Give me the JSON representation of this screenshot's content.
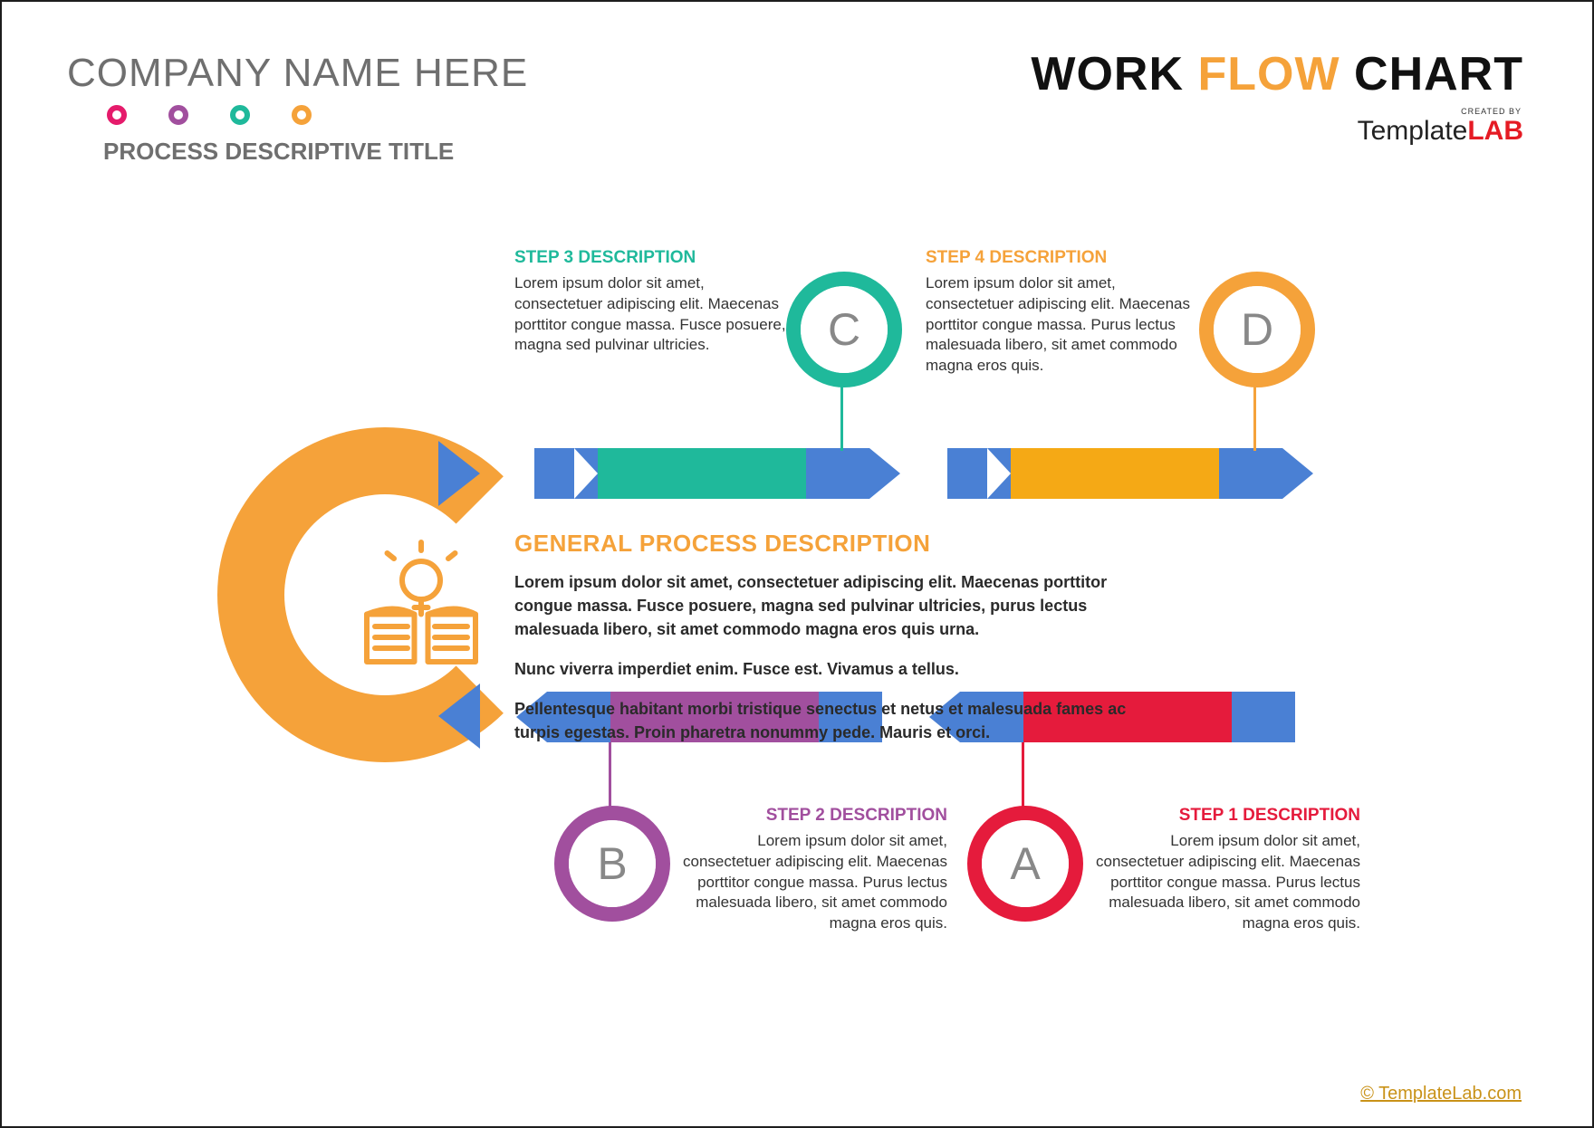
{
  "header": {
    "company_name": "COMPANY NAME HERE",
    "process_subtitle": "PROCESS DESCRIPTIVE TITLE",
    "title_word1": "WORK",
    "title_word2": "FLOW",
    "title_word3": "CHART",
    "logo_created_by": "CREATED BY",
    "logo_template": "Template",
    "logo_lab": "LAB"
  },
  "colors": {
    "pink": "#e51b6b",
    "purple": "#a14f9e",
    "teal": "#1fb99b",
    "orange": "#f5a23a",
    "blue": "#4a80d4",
    "yellow": "#f5a915",
    "red": "#e51b3c",
    "grey_text": "#6f6f6f"
  },
  "dots": [
    "pink",
    "purple",
    "teal",
    "orange"
  ],
  "center": {
    "title": "GENERAL PROCESS DESCRIPTION",
    "p1": "Lorem ipsum dolor sit amet, consectetuer adipiscing elit. Maecenas porttitor congue massa. Fusce posuere, magna sed pulvinar ultricies, purus lectus malesuada libero, sit amet commodo magna eros quis urna.",
    "p2": "Nunc viverra imperdiet enim. Fusce est. Vivamus a tellus.",
    "p3": "Pellentesque habitant morbi tristique senectus et netus et malesuada fames ac turpis egestas. Proin pharetra nonummy pede. Mauris et orci."
  },
  "steps": {
    "c": {
      "letter": "C",
      "title": "STEP 3 DESCRIPTION",
      "body": "Lorem ipsum dolor sit amet, consectetuer adipiscing elit. Maecenas porttitor congue massa. Fusce posuere, magna sed pulvinar ultricies.",
      "color": "teal"
    },
    "d": {
      "letter": "D",
      "title": "STEP 4 DESCRIPTION",
      "body": "Lorem ipsum dolor sit amet, consectetuer adipiscing elit. Maecenas porttitor congue massa. Purus lectus malesuada libero, sit amet commodo magna eros quis.",
      "color": "orange"
    },
    "b": {
      "letter": "B",
      "title": "STEP 2 DESCRIPTION",
      "body": "Lorem ipsum dolor sit amet, consectetuer adipiscing elit. Maecenas porttitor congue massa. Purus lectus malesuada libero, sit amet commodo magna eros quis.",
      "color": "purple"
    },
    "a": {
      "letter": "A",
      "title": "STEP 1 DESCRIPTION",
      "body": "Lorem ipsum dolor sit amet, consectetuer adipiscing elit. Maecenas porttitor congue massa. Purus lectus malesuada libero, sit amet commodo magna eros quis.",
      "color": "red"
    }
  },
  "footer": {
    "link_text": "© TemplateLab.com"
  }
}
